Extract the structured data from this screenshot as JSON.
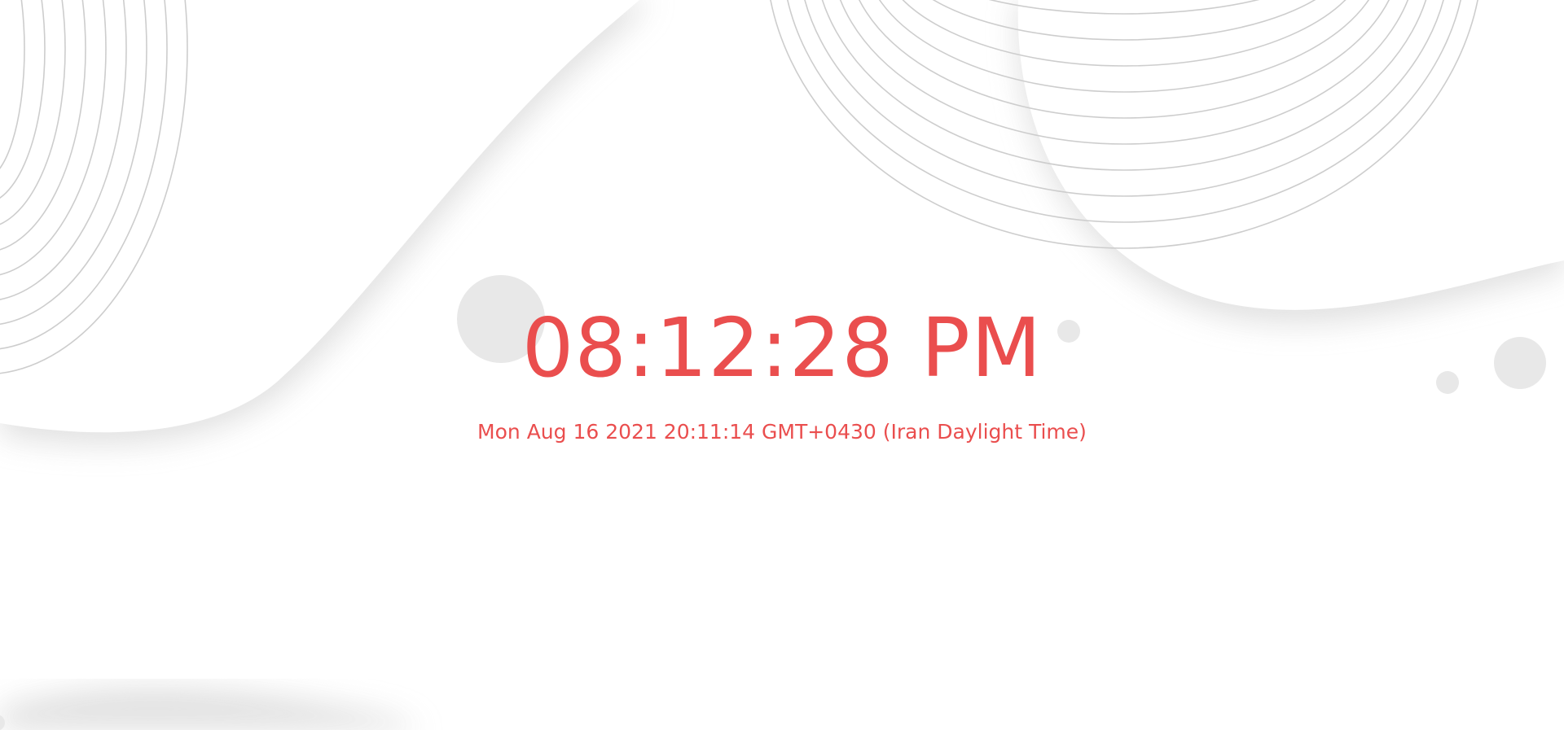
{
  "clock": {
    "time": "08:12:28 PM",
    "date": "Mon Aug 16 2021 20:11:14 GMT+0430 (Iran Daylight Time)"
  },
  "theme": {
    "text_color": "#ea4e4e",
    "background": "#ffffff",
    "wave_shadow": "#e6e6e6",
    "line_color": "#cfcfcf",
    "bubble_color": "#e8e8e8"
  }
}
